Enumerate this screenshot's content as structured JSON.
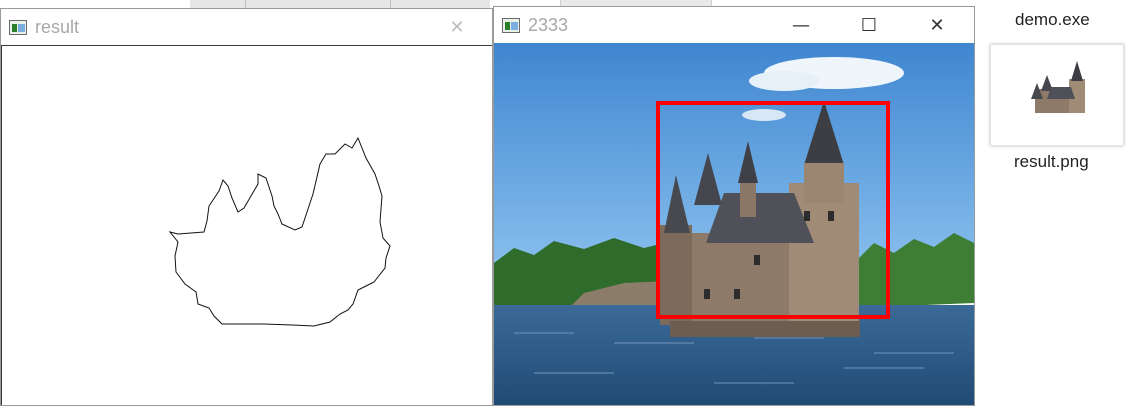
{
  "result_window": {
    "title": "result",
    "close_label": "✕"
  },
  "image_window": {
    "title": "2333",
    "minimize_label": "—",
    "maximize_label": "☐",
    "close_label": "✕"
  },
  "desktop": {
    "exe_label": "demo.exe",
    "png_label": "result.png"
  },
  "colors": {
    "bounding_box": "#ff0000",
    "sky": "#5aa0dc",
    "water": "#2d5a86"
  }
}
